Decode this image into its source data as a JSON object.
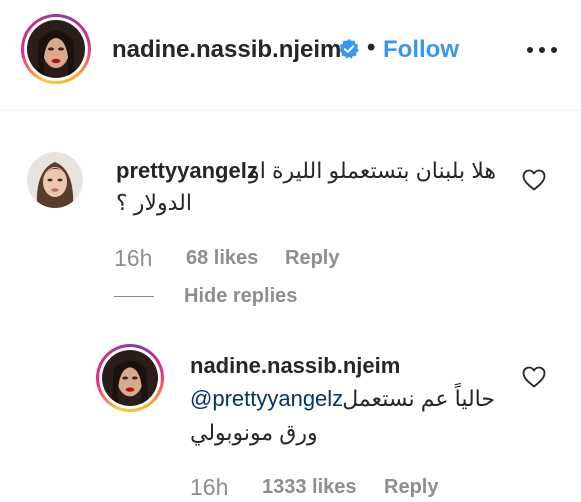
{
  "header": {
    "username": "nadine.nassib.njeim",
    "separator": "•",
    "follow_label": "Follow"
  },
  "comment": {
    "username": "prettyyangelz",
    "text_line1": "هلا بلبنان بتستعملو الليرة او",
    "text_line2": "الدولار ؟",
    "time": "16h",
    "likes": "68 likes",
    "reply_label": "Reply",
    "hide_replies_label": "Hide replies"
  },
  "reply": {
    "username": "nadine.nassib.njeim",
    "mention": "@prettyyangelz",
    "text_line1_rest": "حالياً عم نستعمل",
    "text_line2": "ورق مونوبولي",
    "time": "16h",
    "likes": "1333 likes",
    "reply_label": "Reply"
  },
  "icons": {
    "verified": "verified-badge-icon",
    "more": "more-options-icon",
    "like": "heart-outline-icon"
  },
  "colors": {
    "accent": "#3897f0",
    "mention": "#003569",
    "secondary_text": "#8e8e8e",
    "primary_text": "#262626"
  }
}
